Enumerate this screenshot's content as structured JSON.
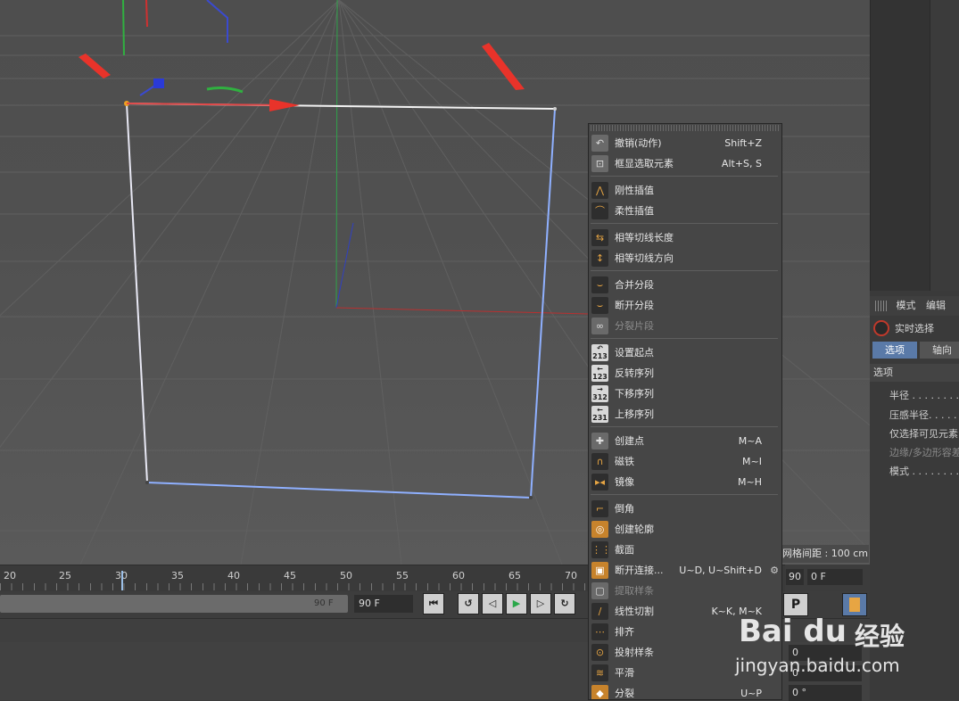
{
  "viewport": {
    "grid_spacing_label": "网格间距 : 100 cm"
  },
  "timeline": {
    "ticks": [
      "20",
      "25",
      "30",
      "35",
      "40",
      "45",
      "50",
      "55",
      "60",
      "65",
      "70"
    ],
    "range_end_label": "90 F",
    "frame_field": "90 F",
    "end_field": "90",
    "current_field": "0 F"
  },
  "transport": {
    "buttons": [
      "go-to-start",
      "prev-key",
      "prev-frame",
      "play",
      "next-frame",
      "next-key"
    ]
  },
  "right_panel": {
    "menu": [
      "模式",
      "编辑"
    ],
    "tool_label": "实时选择",
    "tabs": [
      "选项",
      "轴向"
    ],
    "section_title": "选项",
    "props": [
      {
        "label": "半径 . . . . . . . . .",
        "dim": false
      },
      {
        "label": "压感半径. . . . . .",
        "dim": false
      },
      {
        "label": "仅选择可见元素",
        "dim": false
      },
      {
        "label": "边缘/多边形容差",
        "dim": true
      },
      {
        "label": "模式 . . . . . . . . .",
        "dim": false
      }
    ],
    "fields": [
      "0",
      "0",
      "0 °"
    ]
  },
  "context_menu": {
    "items": [
      {
        "label": "撤销(动作)",
        "shortcut": "Shift+Z",
        "icon": "undo-icon",
        "disabled": false
      },
      {
        "label": "框显选取元素",
        "shortcut": "Alt+S, S",
        "icon": "frame-selection-icon",
        "disabled": false
      },
      {
        "label": "刚性插值",
        "shortcut": "",
        "icon": "hard-interpolation-icon",
        "disabled": false
      },
      {
        "label": "柔性插值",
        "shortcut": "",
        "icon": "soft-interpolation-icon",
        "disabled": false
      },
      {
        "label": "相等切线长度",
        "shortcut": "",
        "icon": "equal-tangent-length-icon",
        "disabled": false
      },
      {
        "label": "相等切线方向",
        "shortcut": "",
        "icon": "equal-tangent-direction-icon",
        "disabled": false
      },
      {
        "label": "合并分段",
        "shortcut": "",
        "icon": "join-segment-icon",
        "disabled": false
      },
      {
        "label": "断开分段",
        "shortcut": "",
        "icon": "break-segment-icon",
        "disabled": false
      },
      {
        "label": "分裂片段",
        "shortcut": "",
        "icon": "explode-segments-icon",
        "disabled": true
      },
      {
        "label": "设置起点",
        "shortcut": "",
        "icon": "set-first-point-icon",
        "disabled": false
      },
      {
        "label": "反转序列",
        "shortcut": "",
        "icon": "reverse-sequence-icon",
        "disabled": false
      },
      {
        "label": "下移序列",
        "shortcut": "",
        "icon": "move-down-sequence-icon",
        "disabled": false
      },
      {
        "label": "上移序列",
        "shortcut": "",
        "icon": "move-up-sequence-icon",
        "disabled": false
      },
      {
        "label": "创建点",
        "shortcut": "M~A",
        "icon": "create-point-icon",
        "disabled": false
      },
      {
        "label": "磁铁",
        "shortcut": "M~I",
        "icon": "magnet-icon",
        "disabled": false
      },
      {
        "label": "镜像",
        "shortcut": "M~H",
        "icon": "mirror-icon",
        "disabled": false
      },
      {
        "label": "倒角",
        "shortcut": "",
        "icon": "chamfer-icon",
        "disabled": false
      },
      {
        "label": "创建轮廓",
        "shortcut": "",
        "icon": "create-outline-icon",
        "disabled": false
      },
      {
        "label": "截面",
        "shortcut": "",
        "icon": "cross-section-icon",
        "disabled": false
      },
      {
        "label": "断开连接...",
        "shortcut": "U~D, U~Shift+D",
        "icon": "disconnect-icon",
        "disabled": false
      },
      {
        "label": "提取样条",
        "shortcut": "",
        "icon": "extract-spline-icon",
        "disabled": true
      },
      {
        "label": "线性切割",
        "shortcut": "K~K, M~K",
        "icon": "knife-icon",
        "disabled": false
      },
      {
        "label": "排齐",
        "shortcut": "",
        "icon": "line-up-icon",
        "disabled": false
      },
      {
        "label": "投射样条",
        "shortcut": "",
        "icon": "project-spline-icon",
        "disabled": false
      },
      {
        "label": "平滑",
        "shortcut": "",
        "icon": "smooth-icon",
        "disabled": false
      },
      {
        "label": "分裂",
        "shortcut": "U~P",
        "icon": "split-icon",
        "disabled": false
      }
    ]
  },
  "watermark": {
    "logo": "Bai du",
    "cn": "经验",
    "url": "jingyan.baidu.com"
  },
  "colors": {
    "accent_blue": "#5a7aa8",
    "annotation_red": "#e8332a",
    "spline_white": "#f0f0f0",
    "spline_blue": "#8fb0ff"
  }
}
